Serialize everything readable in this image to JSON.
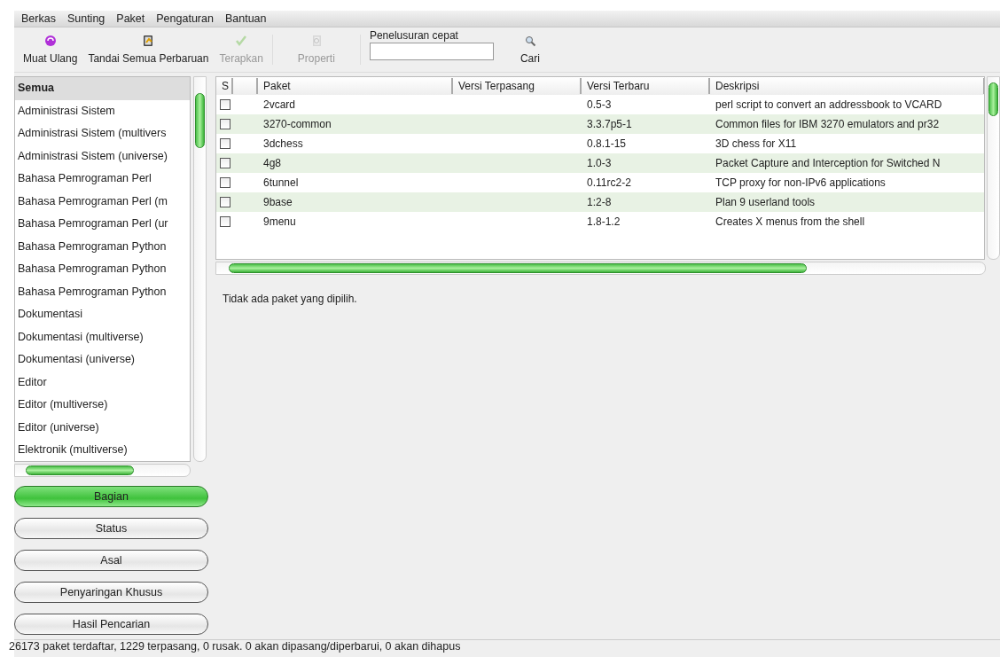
{
  "menu": [
    {
      "label": "Berkas"
    },
    {
      "label": "Sunting"
    },
    {
      "label": "Paket"
    },
    {
      "label": "Pengaturan"
    },
    {
      "label": "Bantuan"
    }
  ],
  "toolbar": {
    "buttons": [
      {
        "label": "Muat Ulang",
        "kind": "reload",
        "disabled": false
      },
      {
        "label": "Tandai Semua Perbaruan",
        "kind": "mark",
        "disabled": false
      },
      {
        "label": "Terapkan",
        "kind": "apply",
        "disabled": true
      },
      {
        "label": "Properti",
        "kind": "properties",
        "disabled": true
      }
    ],
    "search": {
      "label": "Penelusuran cepat"
    },
    "search_button": {
      "label": "Cari"
    }
  },
  "sidebar": {
    "items": [
      {
        "label": "Semua",
        "selected": true
      },
      {
        "label": "Administrasi Sistem",
        "selected": false
      },
      {
        "label": "Administrasi Sistem (multivers",
        "selected": false
      },
      {
        "label": "Administrasi Sistem (universe)",
        "selected": false
      },
      {
        "label": "Bahasa Pemrograman Perl",
        "selected": false
      },
      {
        "label": "Bahasa Pemrograman Perl (m",
        "selected": false
      },
      {
        "label": "Bahasa Pemrograman Perl (ur",
        "selected": false
      },
      {
        "label": "Bahasa Pemrograman Python",
        "selected": false
      },
      {
        "label": "Bahasa Pemrograman Python",
        "selected": false
      },
      {
        "label": "Bahasa Pemrograman Python",
        "selected": false
      },
      {
        "label": "Dokumentasi",
        "selected": false
      },
      {
        "label": "Dokumentasi (multiverse)",
        "selected": false
      },
      {
        "label": "Dokumentasi (universe)",
        "selected": false
      },
      {
        "label": "Editor",
        "selected": false
      },
      {
        "label": "Editor (multiverse)",
        "selected": false
      },
      {
        "label": "Editor (universe)",
        "selected": false
      },
      {
        "label": "Elektronik (multiverse)",
        "selected": false
      }
    ],
    "filters": [
      {
        "label": "Bagian",
        "selected": true
      },
      {
        "label": "Status",
        "selected": false
      },
      {
        "label": "Asal",
        "selected": false
      },
      {
        "label": "Penyaringan Khusus",
        "selected": false
      },
      {
        "label": "Hasil Pencarian",
        "selected": false
      }
    ]
  },
  "table": {
    "columns": [
      "S",
      "Paket",
      "Versi Terpasang",
      "Versi Terbaru",
      "Deskripsi"
    ],
    "rows": [
      {
        "checked": false,
        "name": "2vcard",
        "installed": "",
        "latest": "0.5-3",
        "description": "perl script to convert an addressbook to VCARD"
      },
      {
        "checked": false,
        "name": "3270-common",
        "latest": "3.3.7p5-1",
        "description": "Common files for IBM 3270 emulators and pr32"
      },
      {
        "checked": false,
        "name": "3dchess",
        "latest": "0.8.1-15",
        "description": "3D chess for X11"
      },
      {
        "checked": false,
        "name": "4g8",
        "latest": "1.0-3",
        "description": "Packet Capture and Interception for Switched N"
      },
      {
        "checked": false,
        "name": "6tunnel",
        "latest": "0.11rc2-2",
        "description": "TCP proxy for non-IPv6 applications"
      },
      {
        "checked": false,
        "name": "9base",
        "latest": "1:2-8",
        "description": "Plan 9 userland tools"
      },
      {
        "checked": false,
        "name": "9menu",
        "latest": "1.8-1.2",
        "description": "Creates X menus from the shell"
      }
    ]
  },
  "details": {
    "message": "Tidak ada paket yang dipilih."
  },
  "status_bar": {
    "text": "26173 paket terdaftar, 1229 terpasang, 0 rusak. 0 akan dipasang/diperbarui, 0 akan dihapus"
  }
}
